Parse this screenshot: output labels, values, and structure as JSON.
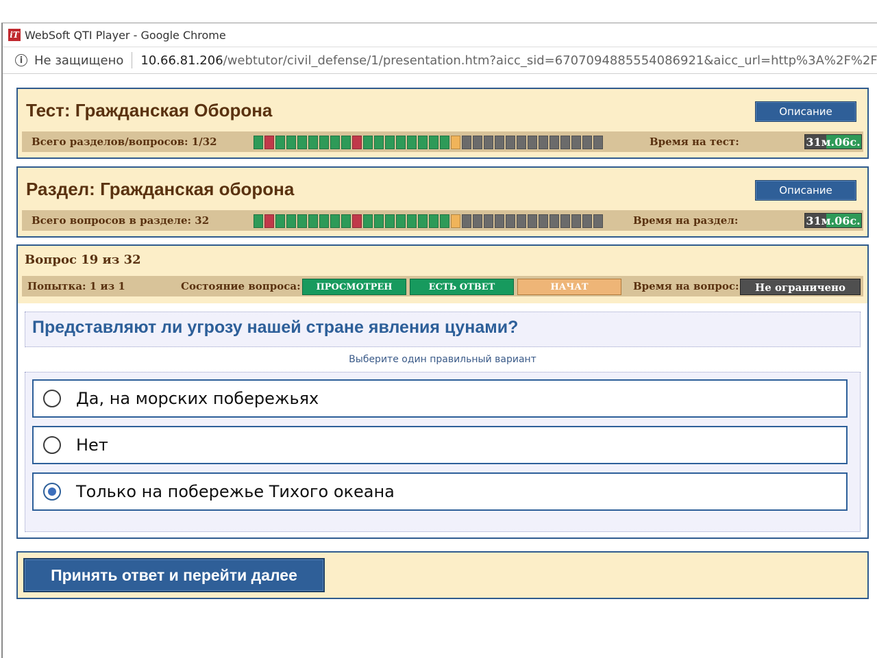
{
  "window": {
    "title": "WebSoft QTI Player - Google Chrome",
    "app_icon": "websoft-logo-icon"
  },
  "address_bar": {
    "security_icon": "info-icon",
    "security_text": "Не защищено",
    "host": "10.66.81.206",
    "path": "/webtutor/civil_defense/1/presentation.htm?aicc_sid=6707094885554086921&aicc_url=http%3A%2F%2F"
  },
  "test": {
    "title": "Тест: Гражданская Оборона",
    "description_button": "Описание",
    "progress_label": "Всего разделов/вопросов: 1/32",
    "time_label": "Время на тест:",
    "time_value": "31м.06с."
  },
  "section": {
    "title": "Раздел: Гражданская оборона",
    "description_button": "Описание",
    "progress_label": "Всего вопросов в разделе: 32",
    "time_label": "Время на раздел:",
    "time_value": "31м.06с."
  },
  "progress_states": [
    "g",
    "r",
    "g",
    "g",
    "g",
    "g",
    "g",
    "g",
    "g",
    "r",
    "g",
    "g",
    "g",
    "g",
    "g",
    "g",
    "g",
    "g",
    "o",
    "d",
    "d",
    "d",
    "d",
    "d",
    "d",
    "d",
    "d",
    "d",
    "d",
    "d",
    "d",
    "d"
  ],
  "question": {
    "number_text": "Вопрос 19 из 32",
    "attempt_text": "Попытка: 1 из 1",
    "state_label": "Состояние вопроса:",
    "state_viewed": "ПРОСМОТРЕН",
    "state_answered": "ЕСТЬ ОТВЕТ",
    "state_started": "НАЧАТ",
    "time_label": "Время на вопрос:",
    "time_value": "Не ограничено",
    "text": "Представляют ли угрозу нашей стране явления цунами?",
    "hint": "Выберите один правильный вариант",
    "options": [
      {
        "label": "Да, на морских побережьях",
        "selected": false
      },
      {
        "label": "Нет",
        "selected": false
      },
      {
        "label": "Только на побережье Тихого океана",
        "selected": true
      }
    ]
  },
  "submit_button": "Принять ответ и перейти далее",
  "colors": {
    "panel_bg": "#fceec8",
    "panel_border": "#2f5b8e",
    "accent_blue": "#2f5f98",
    "progress_green": "#2e9a58",
    "progress_red": "#c0394a",
    "progress_current": "#f0b45a",
    "progress_pending": "#6b6b6b"
  }
}
